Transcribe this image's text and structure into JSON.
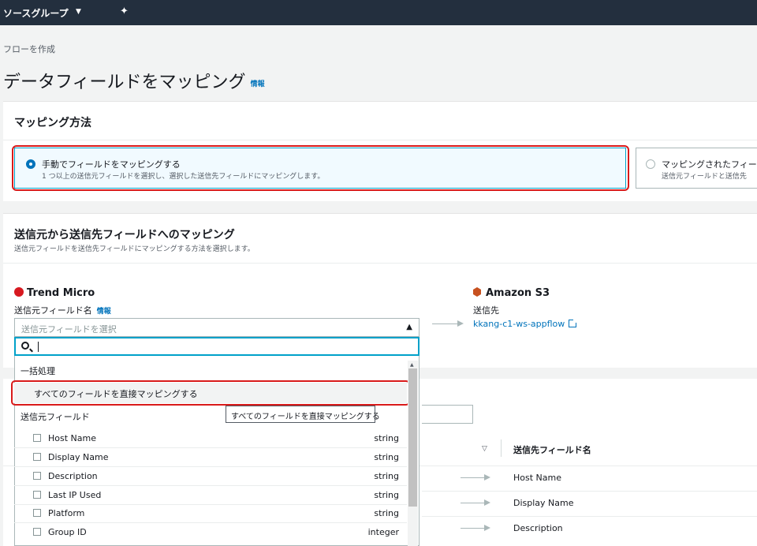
{
  "topbar": {
    "resource_group": "ソースグループ"
  },
  "breadcrumb": "フローを作成",
  "page": {
    "title": "データフィールドをマッピング",
    "info": "情報"
  },
  "mapping_method": {
    "header": "マッピング方法",
    "option_manual": {
      "label": "手動でフィールドをマッピングする",
      "desc": "1 つ以上の送信元フィールドを選択し、選択した送信先フィールドにマッピングします。"
    },
    "option_upload": {
      "label": "マッピングされたフィー",
      "desc": "送信元フィールドと送信先"
    }
  },
  "source_dest": {
    "header": "送信元から送信先フィールドへのマッピング",
    "subtitle": "送信元フィールドを送信先フィールドにマッピングする方法を選択します。",
    "source_name": "Trend Micro",
    "source_field_label": "送信元フィールド名",
    "source_info": "情報",
    "select_placeholder": "送信元フィールドを選択",
    "dest_name": "Amazon S3",
    "dest_label": "送信先",
    "dest_link": "kkang-c1-ws-appflow"
  },
  "dropdown": {
    "group_bulk": "一括処理",
    "bulk_item": "すべてのフィールドを直接マッピングする",
    "tooltip": "すべてのフィールドを直接マッピングする",
    "group_fields": "送信元フィールド",
    "fields": [
      {
        "name": "Host Name",
        "type": "string"
      },
      {
        "name": "Display Name",
        "type": "string"
      },
      {
        "name": "Description",
        "type": "string"
      },
      {
        "name": "Last IP Used",
        "type": "string"
      },
      {
        "name": "Platform",
        "type": "string"
      },
      {
        "name": "Group ID",
        "type": "integer"
      }
    ]
  },
  "table": {
    "dest_header": "送信先フィールド名",
    "rows": [
      "Host Name",
      "Display Name",
      "Description"
    ]
  }
}
